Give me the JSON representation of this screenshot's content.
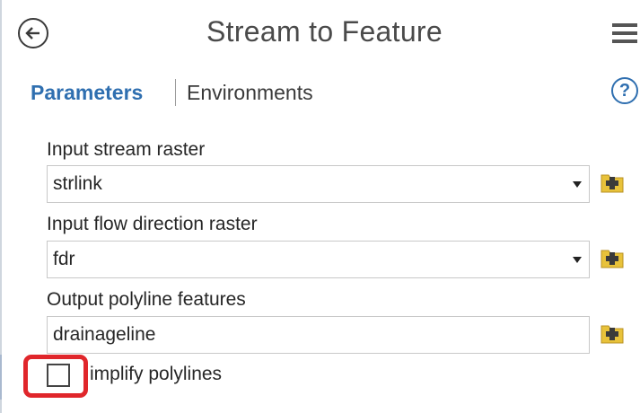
{
  "header": {
    "title": "Stream to Feature"
  },
  "tabs": {
    "parameters": "Parameters",
    "environments": "Environments",
    "help": "?"
  },
  "params": {
    "stream_raster": {
      "label": "Input stream raster",
      "value": "strlink"
    },
    "flow_direction": {
      "label": "Input flow direction raster",
      "value": "fdr"
    },
    "output": {
      "label": "Output polyline features",
      "value": "drainageline"
    }
  },
  "simplify": {
    "label": "implify polylines",
    "checked": false
  },
  "colors": {
    "accent": "#2f6fb0",
    "highlight": "#e0262b",
    "folder": "#e8c23a"
  }
}
